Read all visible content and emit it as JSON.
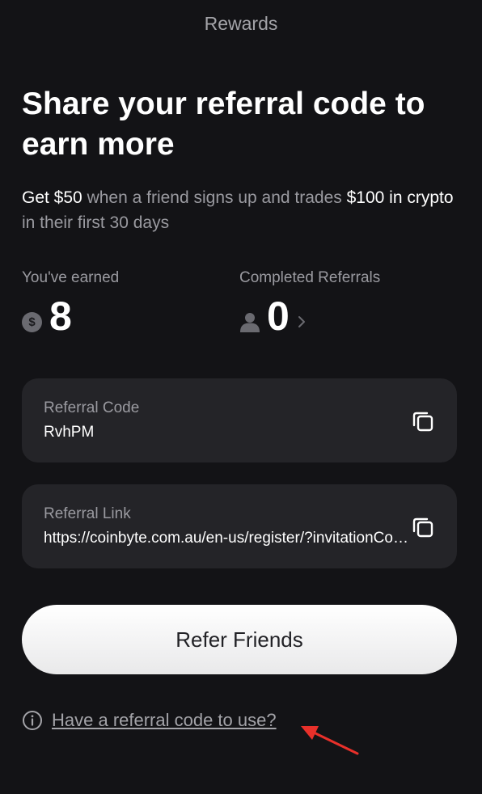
{
  "header": {
    "title": "Rewards"
  },
  "hero": {
    "headline": "Share your referral code to earn more",
    "sub_part1": "Get $50",
    "sub_part2": " when a friend signs up and trades ",
    "sub_part3": "$100 in crypto",
    "sub_part4": " in their first 30 days"
  },
  "stats": {
    "earned_label": "You've earned",
    "earned_value": "8",
    "earned_icon": "dollar-coin-icon",
    "referrals_label": "Completed Referrals",
    "referrals_value": "0",
    "referrals_icon": "person-icon"
  },
  "referral_code": {
    "label": "Referral Code",
    "value": "RvhPM",
    "icon": "copy-icon"
  },
  "referral_link": {
    "label": "Referral Link",
    "value": "https://coinbyte.com.au/en-us/register/?invitationCode=RvhPM",
    "icon": "copy-icon"
  },
  "refer_button": {
    "label": "Refer Friends"
  },
  "have_code": {
    "label": "Have a referral code to use?",
    "icon": "info-icon"
  },
  "colors": {
    "background": "#131316",
    "card": "#242428",
    "muted_text": "#9a9aa0",
    "button": "#ffffff",
    "annotation_arrow": "#e8302a"
  }
}
